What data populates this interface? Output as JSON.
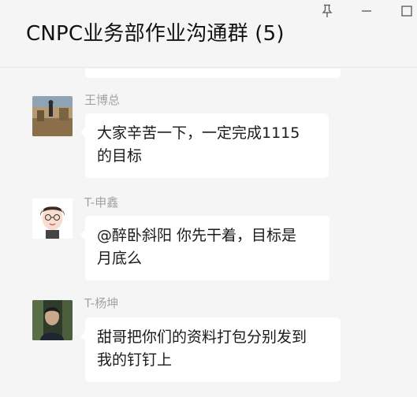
{
  "window": {
    "title": "CNPC业务部作业沟通群 (5)",
    "controls": [
      "pin-icon",
      "minimize-icon",
      "maximize-icon"
    ]
  },
  "messages": [
    {
      "sender": "王博总",
      "text_line1": "大家辛苦一下，一定完成1115",
      "text_line2": "的目标",
      "avatar": "landscape-photo-avatar"
    },
    {
      "sender": "T-申鑫",
      "text_line1": "@醉卧斜阳 你先干着，目标是",
      "text_line2": "月底么",
      "avatar": "cartoon-avatar"
    },
    {
      "sender": "T-杨坤",
      "text_line1": "甜哥把你们的资料打包分别发到",
      "text_line2": "我的钉钉上",
      "avatar": "person-photo-avatar"
    }
  ],
  "colors": {
    "background": "#f5f5f5",
    "bubble": "#ffffff",
    "sender_name": "#a3a3a3",
    "text": "#1a1a1a"
  }
}
